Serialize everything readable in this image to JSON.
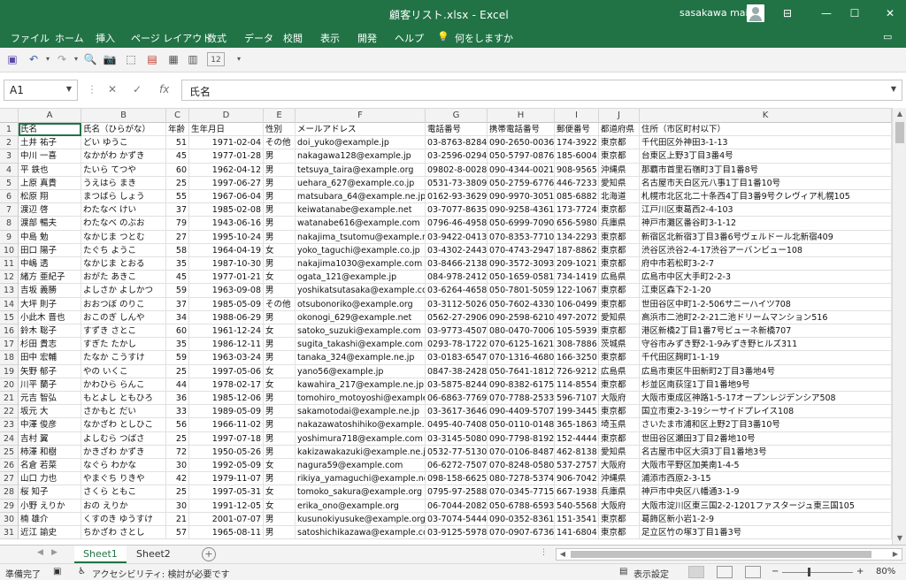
{
  "window": {
    "title": "顧客リスト.xlsx - Excel",
    "user": "sasakawa mai"
  },
  "menu": [
    "ファイル",
    "ホーム",
    "挿入",
    "ページ レイアウト",
    "数式",
    "データ",
    "校閲",
    "表示",
    "開発",
    "ヘルプ",
    "何をしますか"
  ],
  "toolbar": {
    "zoom_box": "12"
  },
  "formula": {
    "cell_ref": "A1",
    "fx": "fx",
    "value": "氏名"
  },
  "columns": [
    "A",
    "B",
    "C",
    "D",
    "E",
    "F",
    "G",
    "H",
    "I",
    "J",
    "K"
  ],
  "rows": [
    [
      "1",
      "氏名",
      "氏名（ひらがな）",
      "年齢",
      "生年月日",
      "性別",
      "メールアドレス",
      "電話番号",
      "携帯電話番号",
      "郵便番号",
      "都道府県",
      "住所（市区町村以下）"
    ],
    [
      "2",
      "土井 祐子",
      "どい ゆうこ",
      "51",
      "1971-02-04",
      "その他",
      "doi_yuko@example.jp",
      "03-8763-8284",
      "090-2650-0036",
      "174-3922",
      "東京都",
      "千代田区外神田3-1-13"
    ],
    [
      "3",
      "中川 一喜",
      "なかがわ かずき",
      "45",
      "1977-01-28",
      "男",
      "nakagawa128@example.jp",
      "03-2596-0294",
      "050-5797-0876",
      "185-6004",
      "東京都",
      "台東区上野3丁目3番4号"
    ],
    [
      "4",
      "平 鉄也",
      "たいら てつや",
      "60",
      "1962-04-12",
      "男",
      "tetsuya_taira@example.org",
      "09802-8-0028",
      "090-4344-0021",
      "908-9565",
      "沖縄県",
      "那覇市首里石嶺町3丁目1番8号"
    ],
    [
      "5",
      "上原 真貴",
      "うえはら まき",
      "25",
      "1997-06-27",
      "男",
      "uehara_627@example.co.jp",
      "0531-73-3809",
      "050-2759-6776",
      "446-7233",
      "愛知県",
      "名古屋市天白区元八事1丁目1番10号"
    ],
    [
      "6",
      "松原 翔",
      "まつばら しょう",
      "55",
      "1967-06-04",
      "男",
      "matsubara_64@example.ne.jp",
      "0162-93-3629",
      "090-9970-3051",
      "085-6882",
      "北海道",
      "札幌市北区北二十条西4丁目3番9号クレヴィア札幌105"
    ],
    [
      "7",
      "渡辺 啓",
      "わたなべ けい",
      "37",
      "1985-02-08",
      "男",
      "keiwatanabe@example.net",
      "03-7077-8635",
      "090-9258-4361",
      "173-7724",
      "東京都",
      "江戸川区東葛西2-4-103"
    ],
    [
      "8",
      "渡部 暢夫",
      "わたなべ のぶお",
      "79",
      "1943-06-16",
      "男",
      "watanabe616@example.com",
      "0796-46-4958",
      "050-6999-7090",
      "656-5980",
      "兵庫県",
      "神戸市灘区番谷町3-1-12"
    ],
    [
      "9",
      "中島 勉",
      "なかじま つとむ",
      "27",
      "1995-10-24",
      "男",
      "nakajima_tsutomu@example.ne",
      "03-9422-0413",
      "070-8353-7710",
      "134-2293",
      "東京都",
      "新宿区北新宿3丁目3番6号ヴェルドール北新宿409"
    ],
    [
      "10",
      "田口 陽子",
      "たぐち ようこ",
      "58",
      "1964-04-19",
      "女",
      "yoko_taguchi@example.co.jp",
      "03-4302-2443",
      "070-4743-2947",
      "187-8862",
      "東京都",
      "渋谷区渋谷2-4-17渋谷アーバンビュー108"
    ],
    [
      "11",
      "中嶋 透",
      "なかじま とおる",
      "35",
      "1987-10-30",
      "男",
      "nakajima1030@example.com",
      "03-8466-2138",
      "090-3572-3093",
      "209-1021",
      "東京都",
      "府中市若松町3-2-7"
    ],
    [
      "12",
      "緒方 亜紀子",
      "おがた あきこ",
      "45",
      "1977-01-21",
      "女",
      "ogata_121@example.jp",
      "084-978-2412",
      "050-1659-0581",
      "734-1419",
      "広島県",
      "広島市中区大手町2-2-3"
    ],
    [
      "13",
      "吉坂 義勝",
      "よしさか よしかつ",
      "59",
      "1963-09-08",
      "男",
      "yoshikatsutasaka@example.co.j",
      "03-6264-4658",
      "050-7801-5059",
      "122-1067",
      "東京都",
      "江東区森下2-1-20"
    ],
    [
      "14",
      "大坪 則子",
      "おおつぼ のりこ",
      "37",
      "1985-05-09",
      "その他",
      "otsubonoriko@example.org",
      "03-3112-5026",
      "050-7602-4330",
      "106-0499",
      "東京都",
      "世田谷区中町1-2-506サニーハイツ708"
    ],
    [
      "15",
      "小此木 晋也",
      "おこのぎ しんや",
      "34",
      "1988-06-29",
      "男",
      "okonogi_629@example.net",
      "0562-27-2906",
      "090-2598-6210",
      "497-2072",
      "愛知県",
      "高浜市二池町2-2-21二池ドリームマンション516"
    ],
    [
      "16",
      "鈴木 聡子",
      "すずき さとこ",
      "60",
      "1961-12-24",
      "女",
      "satoko_suzuki@example.com",
      "03-9773-4507",
      "080-0470-7006",
      "105-5939",
      "東京都",
      "港区新橋2丁目1番7号ビューネ新橋707"
    ],
    [
      "17",
      "杉田 貴志",
      "すぎた たかし",
      "35",
      "1986-12-11",
      "男",
      "sugita_takashi@example.com",
      "0293-78-1722",
      "070-6125-1621",
      "308-7886",
      "茨城県",
      "守谷市みずき野2-1-9みずき野ヒルズ311"
    ],
    [
      "18",
      "田中 宏輔",
      "たなか こうすけ",
      "59",
      "1963-03-24",
      "男",
      "tanaka_324@example.ne.jp",
      "03-0183-6547",
      "070-1316-4680",
      "166-3250",
      "東京都",
      "千代田区麹町1-1-19"
    ],
    [
      "19",
      "矢野 郁子",
      "やの いくこ",
      "25",
      "1997-05-06",
      "女",
      "yano56@example.jp",
      "0847-38-2428",
      "050-7641-1812",
      "726-9212",
      "広島県",
      "広島市東区牛田新町2丁目3番地4号"
    ],
    [
      "20",
      "川平 蘭子",
      "かわひら らんこ",
      "44",
      "1978-02-17",
      "女",
      "kawahira_217@example.ne.jp",
      "03-5875-8244",
      "090-8382-6175",
      "114-8554",
      "東京都",
      "杉並区南荻窪1丁目1番地9号"
    ],
    [
      "21",
      "元吉 智弘",
      "もとよし ともひろ",
      "36",
      "1985-12-06",
      "男",
      "tomohiro_motoyoshi@example.c",
      "06-6863-7769",
      "070-7788-2533",
      "596-7107",
      "大阪府",
      "大阪市東成区神路1-5-17オープンレジデンシア508"
    ],
    [
      "22",
      "坂元 大",
      "さかもと だい",
      "33",
      "1989-05-09",
      "男",
      "sakamotodai@example.ne.jp",
      "03-3617-3646",
      "090-4409-5707",
      "199-3445",
      "東京都",
      "国立市東2-3-19シーサイドプレイス108"
    ],
    [
      "23",
      "中澤 俊彦",
      "なかざわ としひこ",
      "56",
      "1966-11-02",
      "男",
      "nakazawatoshihiko@example.n",
      "0495-40-7408",
      "050-0110-0148",
      "365-1863",
      "埼玉県",
      "さいたま市浦和区上野2丁目3番10号"
    ],
    [
      "24",
      "吉村 翼",
      "よしむら つばさ",
      "25",
      "1997-07-18",
      "男",
      "yoshimura718@example.com",
      "03-3145-5080",
      "090-7798-8192",
      "152-4444",
      "東京都",
      "世田谷区瀬田3丁目2番地10号"
    ],
    [
      "25",
      "柿澤 和樹",
      "かきざわ かずき",
      "72",
      "1950-05-26",
      "男",
      "kakizawakazuki@example.ne.jp",
      "0532-77-5130",
      "070-0106-8487",
      "462-8138",
      "愛知県",
      "名古屋市中区大須3丁目1番地3号"
    ],
    [
      "26",
      "名倉 若菜",
      "なぐら わかな",
      "30",
      "1992-05-09",
      "女",
      "nagura59@example.com",
      "06-6272-7507",
      "070-8248-0580",
      "537-2757",
      "大阪府",
      "大阪市平野区加美南1-4-5"
    ],
    [
      "27",
      "山口 力也",
      "やまぐち りきや",
      "42",
      "1979-11-07",
      "男",
      "rikiya_yamaguchi@example.net",
      "098-158-6625",
      "080-7278-5374",
      "906-7042",
      "沖縄県",
      "浦添市西原2-3-15"
    ],
    [
      "28",
      "桜 知子",
      "さくら ともこ",
      "25",
      "1997-05-31",
      "女",
      "tomoko_sakura@example.org",
      "0795-97-2588",
      "070-0345-7715",
      "667-1938",
      "兵庫県",
      "神戸市中央区八幡通3-1-9"
    ],
    [
      "29",
      "小野 えりか",
      "おの えりか",
      "30",
      "1991-12-05",
      "女",
      "erika_ono@example.org",
      "06-7044-2082",
      "050-6788-6593",
      "540-5568",
      "大阪府",
      "大阪市淀川区東三国2-2-1201ファスタージュ東三国105"
    ],
    [
      "30",
      "楠 雄介",
      "くすのき ゆうすけ",
      "21",
      "2001-07-07",
      "男",
      "kusunokiyusuke@example.org",
      "03-7074-5444",
      "090-0352-8361",
      "151-3541",
      "東京都",
      "葛飾区新小岩1-2-9"
    ],
    [
      "31",
      "近江 諭史",
      "ちかざわ さとし",
      "57",
      "1965-08-11",
      "男",
      "satoshichikazawa@example.co",
      "03-9125-5978",
      "070-0907-6736",
      "141-6804",
      "東京都",
      "足立区竹の塚3丁目1番3号"
    ]
  ],
  "sheets": {
    "active": "Sheet1",
    "other": "Sheet2"
  },
  "status": {
    "ready": "準備完了",
    "accessibility": "アクセシビリティ: 検討が必要です",
    "display_settings": "表示設定",
    "zoom": "80%"
  }
}
